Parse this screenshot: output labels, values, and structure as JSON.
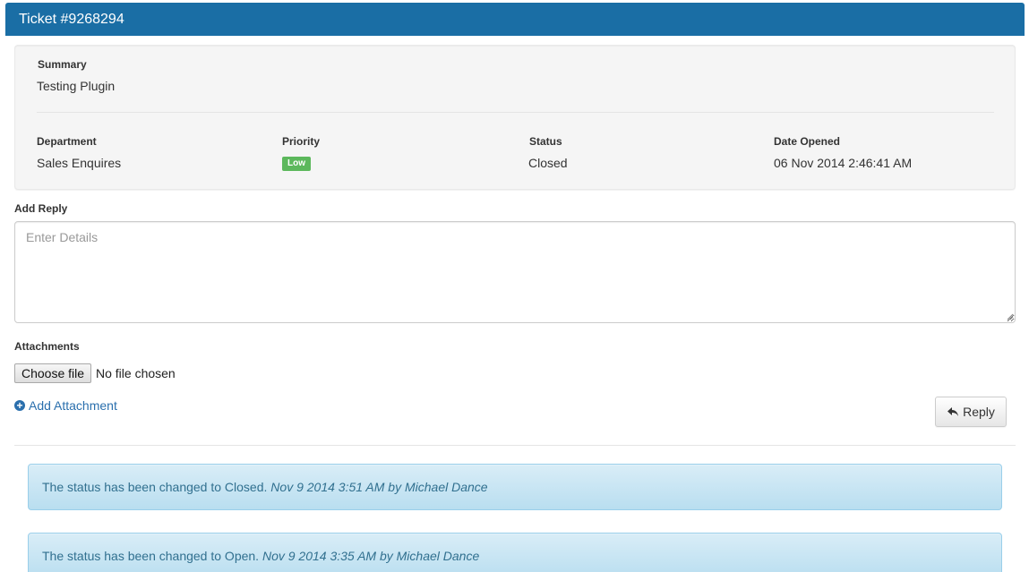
{
  "ticket": {
    "title": "Ticket #9268294"
  },
  "summary": {
    "label": "Summary",
    "value": "Testing Plugin"
  },
  "details": {
    "department_label": "Department",
    "department_value": "Sales Enquires",
    "priority_label": "Priority",
    "priority_value": "Low",
    "status_label": "Status",
    "status_value": "Closed",
    "date_label": "Date Opened",
    "date_value": "06 Nov 2014 2:46:41 AM"
  },
  "reply": {
    "label": "Add Reply",
    "placeholder": "Enter Details"
  },
  "attachments": {
    "label": "Attachments",
    "choose_button": "Choose file",
    "file_status": "No file chosen",
    "add_link": "Add Attachment"
  },
  "actions": {
    "reply_button": "Reply"
  },
  "history": [
    {
      "text": "The status has been changed to Closed.",
      "meta": "Nov 9 2014 3:51 AM by Michael Dance"
    },
    {
      "text": "The status has been changed to Open.",
      "meta": "Nov 9 2014 3:35 AM by Michael Dance"
    }
  ],
  "colors": {
    "header": "#1a6ea5",
    "priority_low": "#5cb85c",
    "link": "#2a6fad",
    "alert_text": "#31708f"
  }
}
